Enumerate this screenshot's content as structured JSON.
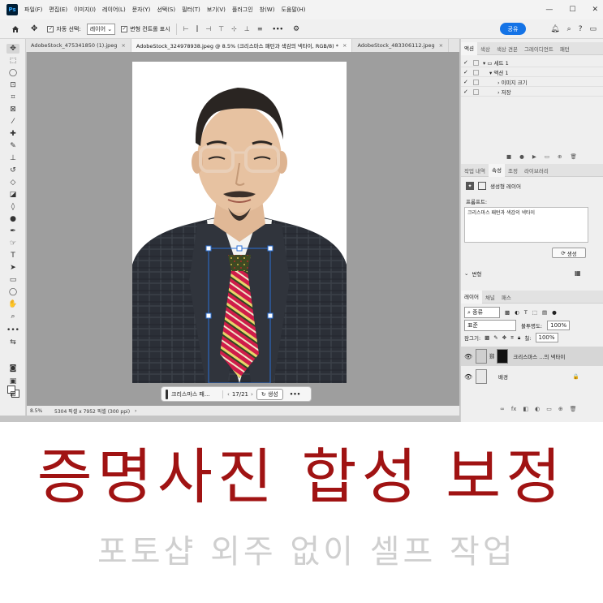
{
  "app": {
    "logo_text": "Ps",
    "menu": [
      "파일(F)",
      "편집(E)",
      "이미지(I)",
      "레이어(L)",
      "문자(Y)",
      "선택(S)",
      "필터(T)",
      "보기(V)",
      "플러그인",
      "창(W)",
      "도움말(H)"
    ],
    "window_controls": {
      "minimize": "—",
      "maximize": "☐",
      "close": "✕"
    }
  },
  "options_bar": {
    "home_icon": "home-icon",
    "auto_select_label": "자동 선택:",
    "auto_select_checked": "✓",
    "layer_select_value": "레이어",
    "transform_controls_label": "변형 컨트롤 표시",
    "transform_checked": "✓",
    "more_label": "•••",
    "share_label": "공유"
  },
  "tabs": [
    {
      "label": "AdobeStock_475341850 (1).jpeg",
      "close": "×",
      "active": false
    },
    {
      "label": "AdobeStock_324978938.jpeg @ 8.5% (크리스마스 패턴과 색감의 넥타이, RGB/8) *",
      "close": "×",
      "active": true
    },
    {
      "label": "AdobeStock_483306112.jpeg",
      "close": "×",
      "active": false
    }
  ],
  "context_bar": {
    "prompt_text": "크리스마스 패...",
    "nav_prev": "‹",
    "count": "17/21",
    "nav_next": "›",
    "generate_label": "생성",
    "more_label": "•••"
  },
  "status_bar": {
    "zoom": "8.5%",
    "info": "5304 픽셀 x 7952 픽셀 (300 ppi)",
    "arrow": "›"
  },
  "panels": {
    "top_tabs": [
      "액션",
      "색상",
      "색상 견본",
      "그레이디언트",
      "패턴"
    ],
    "actions": [
      {
        "check": "✓",
        "label": "▾ ▭ 세트 1"
      },
      {
        "check": "✓",
        "label": "  ▾ 액션 1"
      },
      {
        "check": "✓",
        "label": "      › 이미지 크기"
      },
      {
        "check": "✓",
        "label": "      › 저장"
      }
    ],
    "action_controls": [
      "■",
      "●",
      "▶",
      "▭",
      "⊕",
      "🗑"
    ],
    "mid_tabs": [
      "작업 내역",
      "속성",
      "조정",
      "라이브러리"
    ],
    "properties": {
      "layer_type": "생성형 레이어",
      "prompt_label": "프롬프트:",
      "prompt_value": "크리스마스 패턴과 색감의 넥타이",
      "generate_label": "생성",
      "variations_label": "변형"
    },
    "layers": {
      "tabs": [
        "레이어",
        "채널",
        "패스"
      ],
      "filter_value": "종류",
      "blend_mode": "표준",
      "opacity_label": "불투명도:",
      "opacity_value": "100%",
      "lock_label": "잠그기:",
      "fill_label": "칠:",
      "fill_value": "100%",
      "items": [
        {
          "name": "크리스마스 ...의 넥타이",
          "visible": "👁",
          "selected": true
        },
        {
          "name": "배경",
          "visible": "👁",
          "selected": false,
          "lock": "🔒"
        }
      ],
      "footer_icons": [
        "∞",
        "fx",
        "◧",
        "◐",
        "▭",
        "⊕",
        "🗑"
      ]
    }
  },
  "banner": {
    "title": "증명사진 합성 보정",
    "subtitle": "포토샵 외주 없이 셀프 작업"
  },
  "colors": {
    "accent": "#1473e6",
    "title": "#a01313",
    "subtitle": "#cfcfcf",
    "canvas_bg": "#9e9e9e"
  }
}
